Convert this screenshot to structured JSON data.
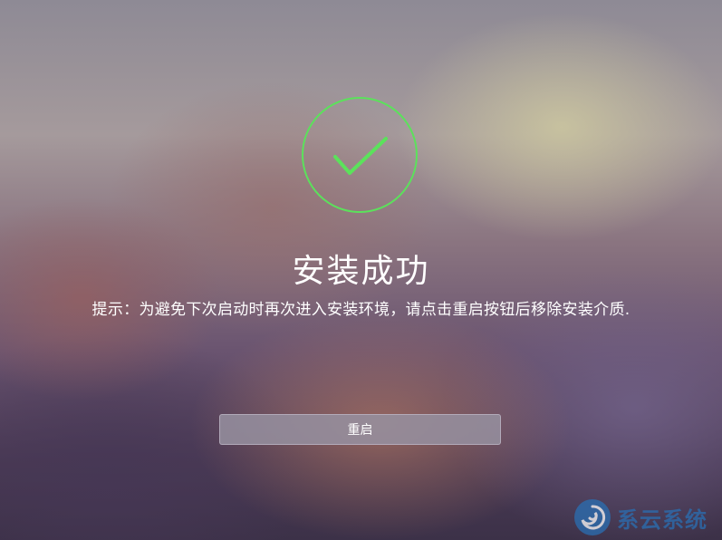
{
  "screen": {
    "title": "安装成功",
    "hint": "提示：为避免下次启动时再次进入安装环境，请点击重启按钮后移除安装介质.",
    "restart_label": "重启",
    "success_icon": "checkmark-circle-icon",
    "success_color": "#5be25b"
  },
  "watermark": {
    "text": "系云系统",
    "logo_icon": "swirl-logo-icon",
    "color": "#2a6fb3"
  }
}
